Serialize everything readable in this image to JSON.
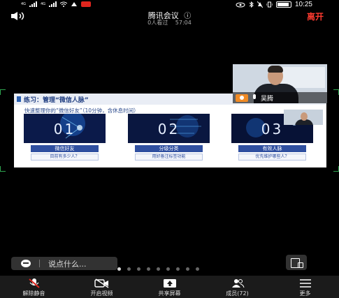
{
  "status_bar": {
    "network_left": "4G",
    "network_right": "4G",
    "time": "10:25"
  },
  "meeting": {
    "app_title": "腾讯会议",
    "info_icon": "ⓘ",
    "watch_status": "0人看过",
    "duration": "57:04",
    "leave_label": "离开"
  },
  "slide": {
    "heading": "练习：管理“微信人脉”",
    "intro": "快速整理你的“微信好友”（10分钟，含休息时间）",
    "cards": [
      {
        "number": "01",
        "title": "微信好友",
        "subtitle": "目前有多少人？"
      },
      {
        "number": "02",
        "title": "分级分类",
        "subtitle": "用好备注标签功能"
      },
      {
        "number": "03",
        "title": "有效人脉",
        "subtitle": "优先维护哪些人？"
      }
    ]
  },
  "video": {
    "participant_name": "吴腾"
  },
  "chat": {
    "placeholder": "说点什么..."
  },
  "page_indicator": {
    "count": 9,
    "active_index": 0
  },
  "toolbar": {
    "unmute_label": "解除静音",
    "video_label": "开启视频",
    "share_label": "共享屏幕",
    "members_label": "成员(72)",
    "more_label": "更多"
  },
  "colors": {
    "leave": "#ff3b30",
    "mute_red": "#e0261e",
    "share_corner": "#2ea44f",
    "slide_blue": "#2f4fa0"
  }
}
